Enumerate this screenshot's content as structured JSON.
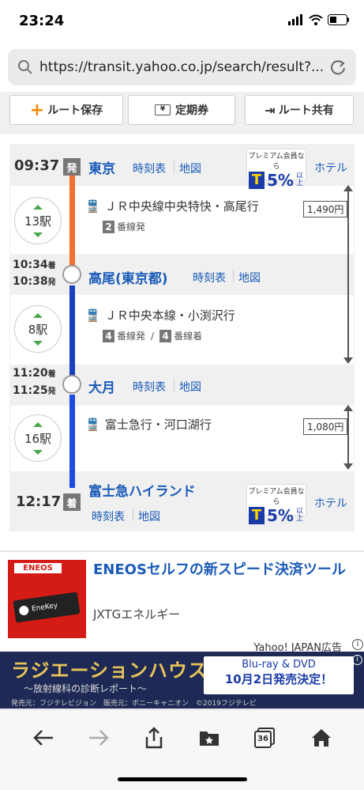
{
  "status": {
    "time": "23:24"
  },
  "browser": {
    "url": "https://transit.yahoo.co.jp/search/result?..."
  },
  "actions": {
    "save": "ルート保存",
    "teiki": "定期券",
    "share": "ルート共有"
  },
  "route": {
    "stations": [
      {
        "name": "東京",
        "time": "09:37",
        "kind": "発",
        "timetable": "時刻表",
        "map": "地図",
        "hotel": "ホテル"
      },
      {
        "name": "高尾(東京都)",
        "arr": "10:34",
        "dep": "10:38",
        "arr_kind": "着",
        "dep_kind": "発",
        "timetable": "時刻表",
        "map": "地図"
      },
      {
        "name": "大月",
        "arr": "11:20",
        "dep": "11:25",
        "arr_kind": "着",
        "dep_kind": "発",
        "timetable": "時刻表",
        "map": "地図"
      },
      {
        "name": "富士急ハイランド",
        "time": "12:17",
        "kind": "着",
        "timetable": "時刻表",
        "map": "地図",
        "hotel": "ホテル"
      }
    ],
    "segments": [
      {
        "count": "13駅",
        "train": "ＪＲ中央線中央特快・高尾行",
        "platform_dep": "2",
        "platform_dep_label": "番線発",
        "line_color": "#f07030"
      },
      {
        "count": "8駅",
        "train": "ＪＲ中央本線・小渕沢行",
        "platform_dep": "4",
        "platform_dep_label": "番線発",
        "slash": "/",
        "platform_arr": "4",
        "platform_arr_label": "番線着",
        "line_color": "#1a3fbf"
      },
      {
        "count": "16駅",
        "train": "富士急行・河口湖行",
        "line_color": "#1f4be0"
      }
    ],
    "fares": [
      "1,490円",
      "1,080円"
    ],
    "tpoint": {
      "top": "プレミアム会員なら",
      "mark": "T",
      "pct": "5%",
      "suffix": "以上",
      "brand": "T-POINT"
    }
  },
  "ad": {
    "brand": "ENEOS",
    "card_label": "EneKey",
    "title": "ENEOSセルフの新スピード決済ツール",
    "advertiser": "JXTGエネルギー",
    "label": "Yahoo! JAPAN広告"
  },
  "banner": {
    "title": "ラジエーションハウス",
    "subtitle": "～放射線科の診断レポート～",
    "right1": "Blu-ray & DVD",
    "right2": "10月2日発売決定！",
    "credit": "発売元：フジテレビジョン　販売元：ポニーキャニオン　©2019フジテレビ"
  },
  "toolbar": {
    "tabs": "36"
  },
  "colors": {
    "link": "#1a5bb8",
    "orange": "#f07030",
    "blue": "#1a3fbf",
    "green": "#4ca64c"
  }
}
